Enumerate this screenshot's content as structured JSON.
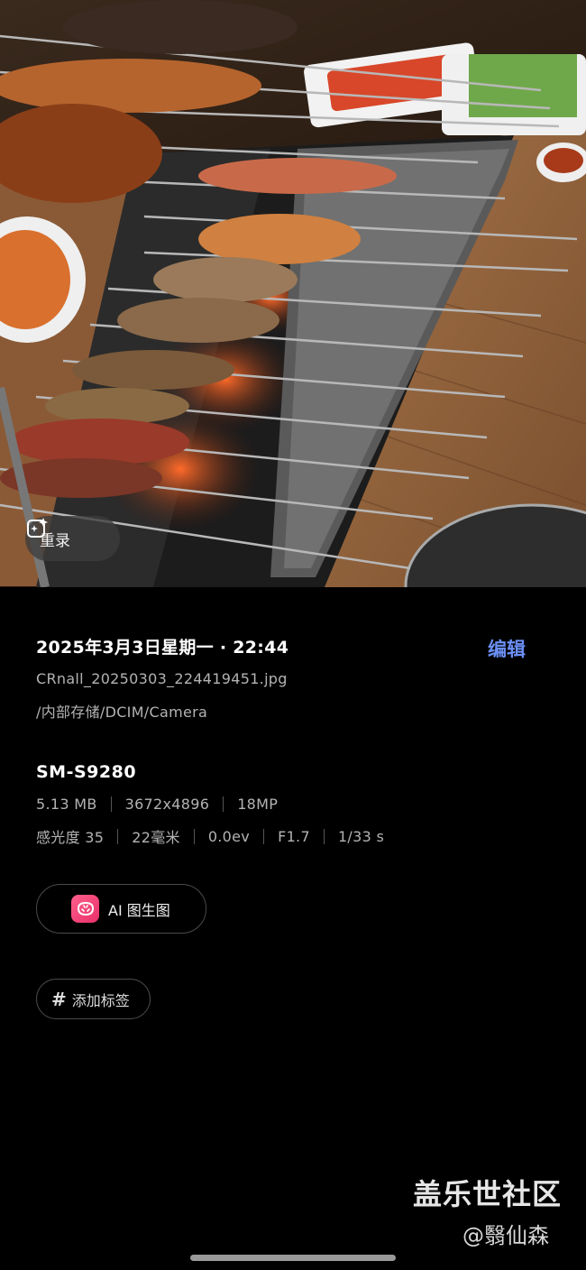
{
  "photo": {
    "remaster_button_label": "重录",
    "remaster_icon": "sparkle-image-icon"
  },
  "details": {
    "datetime": "2025年3月3日星期一 · 22:44",
    "edit_label": "编辑",
    "filename": "CRnall_20250303_224419451.jpg",
    "path": "/内部存储/DCIM/Camera",
    "device_model": "SM-S9280",
    "file_size": "5.13 MB",
    "resolution": "3672x4896",
    "megapixels": "18MP",
    "iso": "感光度 35",
    "focal_length": "22毫米",
    "exposure": "0.0ev",
    "aperture": "F1.7",
    "shutter": "1/33 s"
  },
  "actions": {
    "ai_button_label": "AI 图生图",
    "ai_icon": "meitu-app-icon",
    "add_tag_label": "添加标签",
    "tag_icon": "hash-icon"
  },
  "watermark": {
    "line1": "盖乐世社区",
    "line2": "@翳仙森"
  },
  "colors": {
    "accent": "#6b8ff5",
    "background": "#000000"
  }
}
